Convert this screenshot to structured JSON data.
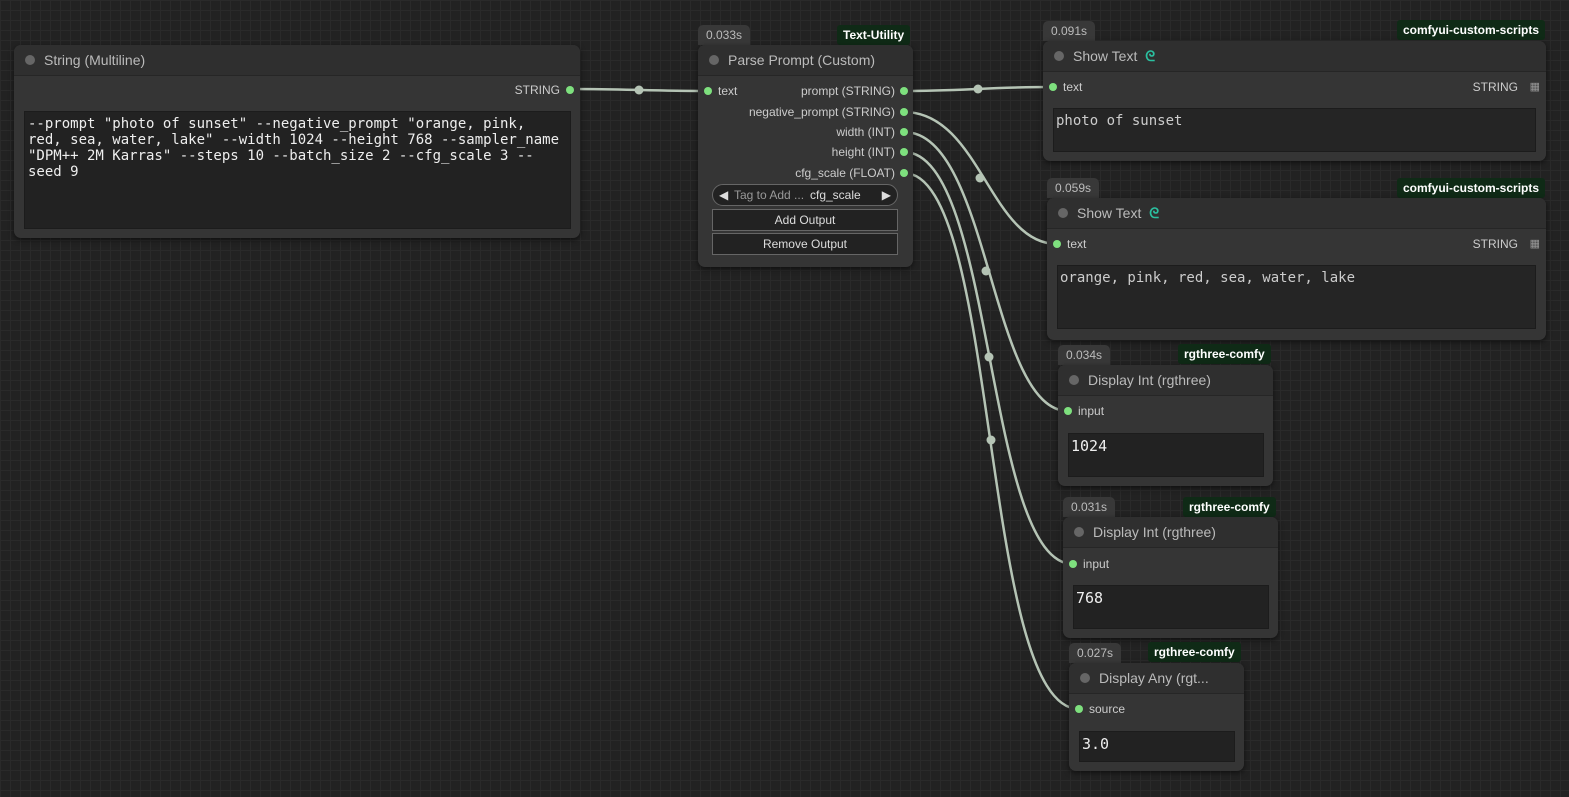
{
  "nodes": {
    "string_multiline": {
      "title": "String (Multiline)",
      "output_label": "STRING",
      "text": "--prompt \"photo of sunset\" --negative_prompt \"orange, pink, red, sea, water, lake\" --width 1024 --height 768 --sampler_name \"DPM++ 2M Karras\" --steps 10 --batch_size 2 --cfg_scale 3 --seed 9"
    },
    "parse_prompt": {
      "timing": "0.033s",
      "badge": "Text-Utility",
      "title": "Parse Prompt (Custom)",
      "input_label": "text",
      "outputs": [
        "prompt (STRING)",
        "negative_prompt (STRING)",
        "width (INT)",
        "height (INT)",
        "cfg_scale (FLOAT)"
      ],
      "tag_combo": {
        "left_arrow": "◀",
        "label": "Tag to Add ...",
        "value": "cfg_scale",
        "right_arrow": "▶"
      },
      "add_output_label": "Add Output",
      "remove_output_label": "Remove Output"
    },
    "show_text_1": {
      "timing": "0.091s",
      "badge": "comfyui-custom-scripts",
      "title": "Show Text",
      "icon_glyph": "ᘓ",
      "input_label": "text",
      "output_label": "STRING",
      "grid_glyph": "▦",
      "text": "photo of sunset"
    },
    "show_text_2": {
      "timing": "0.059s",
      "badge": "comfyui-custom-scripts",
      "title": "Show Text",
      "icon_glyph": "ᘓ",
      "input_label": "text",
      "output_label": "STRING",
      "grid_glyph": "▦",
      "text": "orange, pink, red, sea, water, lake"
    },
    "display_int_1": {
      "timing": "0.034s",
      "badge": "rgthree-comfy",
      "title": "Display Int (rgthree)",
      "input_label": "input",
      "value": "1024"
    },
    "display_int_2": {
      "timing": "0.031s",
      "badge": "rgthree-comfy",
      "title": "Display Int (rgthree)",
      "input_label": "input",
      "value": "768"
    },
    "display_any": {
      "timing": "0.027s",
      "badge": "rgthree-comfy",
      "title": "Display Any (rgt...",
      "input_label": "source",
      "value": "3.0"
    }
  },
  "colors": {
    "wire": "#b5c4b5",
    "slot": "#7ee07e",
    "badge_bg": "#0f2a16"
  }
}
